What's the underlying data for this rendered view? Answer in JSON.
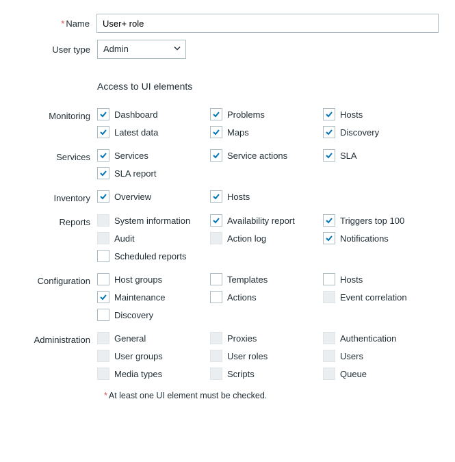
{
  "name_label": "Name",
  "name_value": "User+ role",
  "user_type_label": "User type",
  "user_type_value": "Admin",
  "section_title": "Access to UI elements",
  "groups": [
    {
      "label": "Monitoring",
      "items": [
        {
          "name": "monitoring-dashboard",
          "label": "Dashboard",
          "checked": true,
          "enabled": true
        },
        {
          "name": "monitoring-problems",
          "label": "Problems",
          "checked": true,
          "enabled": true
        },
        {
          "name": "monitoring-hosts",
          "label": "Hosts",
          "checked": true,
          "enabled": true
        },
        {
          "name": "monitoring-latest-data",
          "label": "Latest data",
          "checked": true,
          "enabled": true
        },
        {
          "name": "monitoring-maps",
          "label": "Maps",
          "checked": true,
          "enabled": true
        },
        {
          "name": "monitoring-discovery",
          "label": "Discovery",
          "checked": true,
          "enabled": true
        }
      ]
    },
    {
      "label": "Services",
      "items": [
        {
          "name": "services-services",
          "label": "Services",
          "checked": true,
          "enabled": true
        },
        {
          "name": "services-service-actions",
          "label": "Service actions",
          "checked": true,
          "enabled": true
        },
        {
          "name": "services-sla",
          "label": "SLA",
          "checked": true,
          "enabled": true
        },
        {
          "name": "services-sla-report",
          "label": "SLA report",
          "checked": true,
          "enabled": true
        }
      ]
    },
    {
      "label": "Inventory",
      "items": [
        {
          "name": "inventory-overview",
          "label": "Overview",
          "checked": true,
          "enabled": true
        },
        {
          "name": "inventory-hosts",
          "label": "Hosts",
          "checked": true,
          "enabled": true
        }
      ]
    },
    {
      "label": "Reports",
      "items": [
        {
          "name": "reports-system-information",
          "label": "System information",
          "checked": false,
          "enabled": false
        },
        {
          "name": "reports-availability-report",
          "label": "Availability report",
          "checked": true,
          "enabled": true
        },
        {
          "name": "reports-triggers-top-100",
          "label": "Triggers top 100",
          "checked": true,
          "enabled": true
        },
        {
          "name": "reports-audit",
          "label": "Audit",
          "checked": false,
          "enabled": false
        },
        {
          "name": "reports-action-log",
          "label": "Action log",
          "checked": false,
          "enabled": false
        },
        {
          "name": "reports-notifications",
          "label": "Notifications",
          "checked": true,
          "enabled": true
        },
        {
          "name": "reports-scheduled-reports",
          "label": "Scheduled reports",
          "checked": false,
          "enabled": true
        }
      ]
    },
    {
      "label": "Configuration",
      "items": [
        {
          "name": "configuration-host-groups",
          "label": "Host groups",
          "checked": false,
          "enabled": true
        },
        {
          "name": "configuration-templates",
          "label": "Templates",
          "checked": false,
          "enabled": true
        },
        {
          "name": "configuration-hosts",
          "label": "Hosts",
          "checked": false,
          "enabled": true
        },
        {
          "name": "configuration-maintenance",
          "label": "Maintenance",
          "checked": true,
          "enabled": true
        },
        {
          "name": "configuration-actions",
          "label": "Actions",
          "checked": false,
          "enabled": true
        },
        {
          "name": "configuration-event-correlation",
          "label": "Event correlation",
          "checked": false,
          "enabled": false
        },
        {
          "name": "configuration-discovery",
          "label": "Discovery",
          "checked": false,
          "enabled": true
        }
      ]
    },
    {
      "label": "Administration",
      "items": [
        {
          "name": "administration-general",
          "label": "General",
          "checked": false,
          "enabled": false
        },
        {
          "name": "administration-proxies",
          "label": "Proxies",
          "checked": false,
          "enabled": false
        },
        {
          "name": "administration-authentication",
          "label": "Authentication",
          "checked": false,
          "enabled": false
        },
        {
          "name": "administration-user-groups",
          "label": "User groups",
          "checked": false,
          "enabled": false
        },
        {
          "name": "administration-user-roles",
          "label": "User roles",
          "checked": false,
          "enabled": false
        },
        {
          "name": "administration-users",
          "label": "Users",
          "checked": false,
          "enabled": false
        },
        {
          "name": "administration-media-types",
          "label": "Media types",
          "checked": false,
          "enabled": false
        },
        {
          "name": "administration-scripts",
          "label": "Scripts",
          "checked": false,
          "enabled": false
        },
        {
          "name": "administration-queue",
          "label": "Queue",
          "checked": false,
          "enabled": false
        }
      ]
    }
  ],
  "hint_text": "At least one UI element must be checked."
}
